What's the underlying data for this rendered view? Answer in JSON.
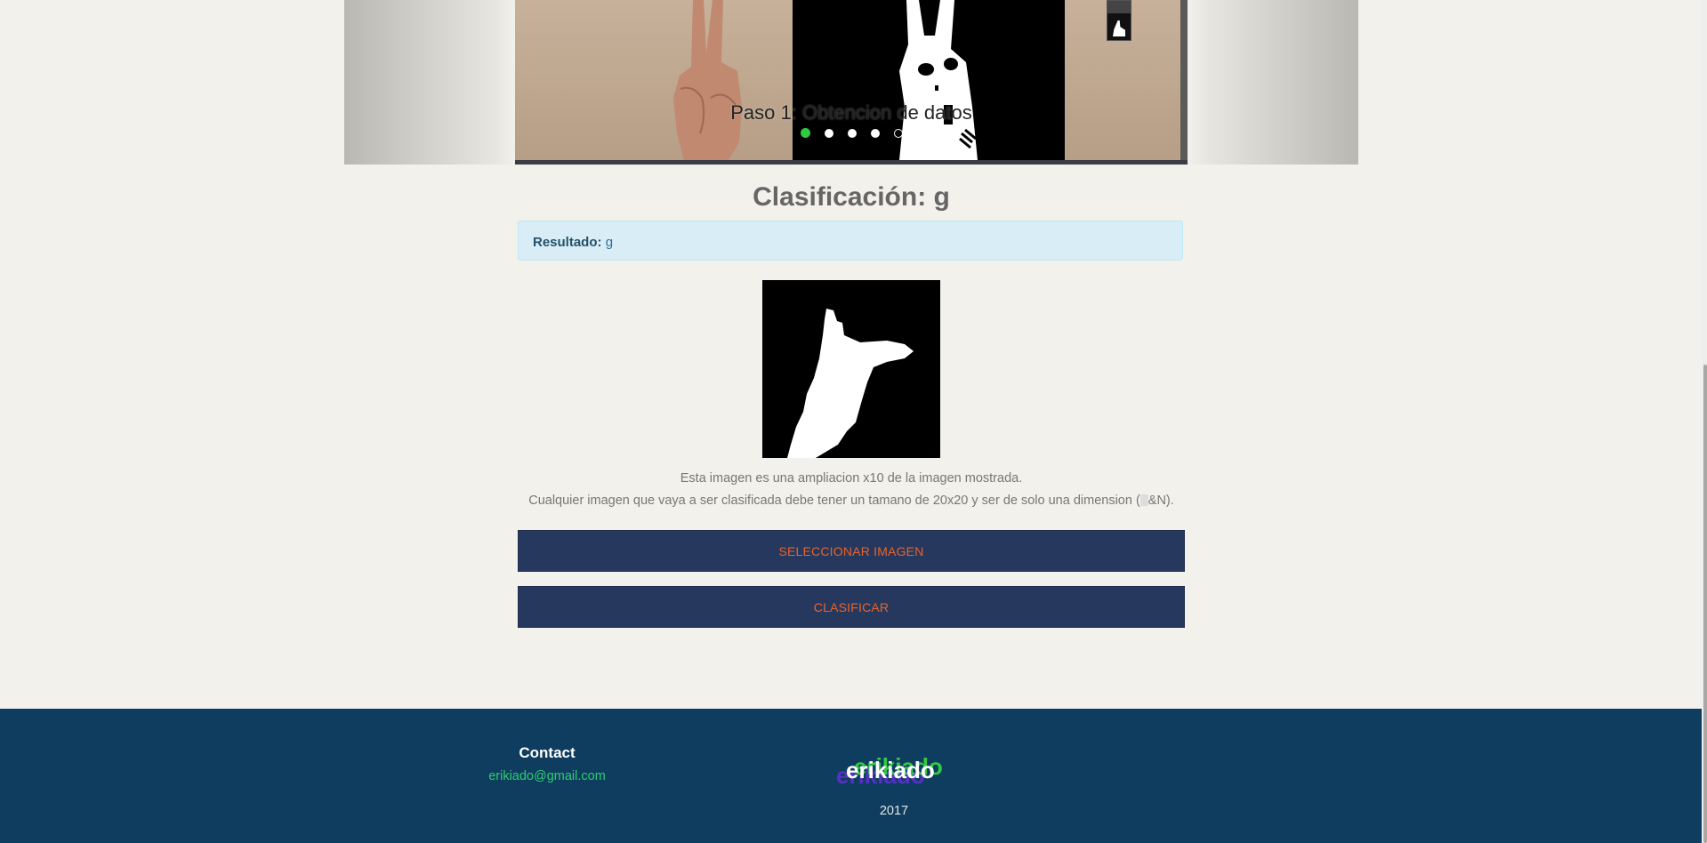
{
  "carousel": {
    "caption": "Paso 1: Obtencion de datos",
    "indicators": [
      "slide-1",
      "slide-2",
      "slide-3",
      "slide-4",
      "slide-5"
    ],
    "active_index": 0
  },
  "main": {
    "title": "Clasificación: g",
    "result_label": "Resultado:",
    "result_value": "g",
    "note_line1": "Esta imagen es una ampliacion x10 de la imagen mostrada.",
    "note_line2_a": "Cualquier imagen que vaya a ser clasificada debe tener un tamano de 20x20 y ser de solo una dimension (",
    "note_line2_b": "&N).",
    "select_button": "SELECCIONAR IMAGEN",
    "classify_button": "CLASIFICAR"
  },
  "footer": {
    "contact_title": "Contact",
    "contact_email": "erikiado@gmail.com",
    "logo_text": "erikiado",
    "year": "2017"
  },
  "colors": {
    "page_bg": "#f3f1ec",
    "button_bg": "#27385e",
    "button_text": "#e8632b",
    "alert_bg": "#d9edf7",
    "footer_bg": "#0f3d5f",
    "active_indicator": "#2ecc40",
    "email": "#2ecc71"
  }
}
